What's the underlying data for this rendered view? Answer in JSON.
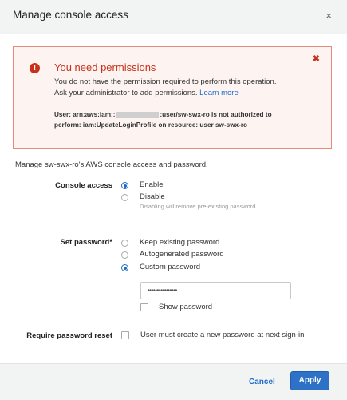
{
  "dialog": {
    "title": "Manage console access",
    "close_glyph": "×"
  },
  "alert": {
    "icon": "error-icon",
    "dismiss_glyph": "✖",
    "heading": "You need permissions",
    "message_line1": "You do not have the permission required to perform this operation.",
    "message_line2": "Ask your administrator to add permissions.",
    "learn_more": "Learn more",
    "detail_prefix": "User: arn:aws:iam::",
    "detail_suffix": ":user/sw-swx-ro is not authorized to",
    "detail_line2": "perform: iam:UpdateLoginProfile on resource: user sw-swx-ro",
    "color": "#c7311a"
  },
  "description": "Manage sw-swx-ro's AWS console access and password.",
  "console_access": {
    "label": "Console access",
    "options": [
      {
        "label": "Enable",
        "selected": true
      },
      {
        "label": "Disable",
        "selected": false
      }
    ],
    "disable_hint": "Disabling will remove pre-existing password."
  },
  "set_password": {
    "label": "Set password*",
    "options": [
      {
        "label": "Keep existing password",
        "selected": false
      },
      {
        "label": "Autogenerated password",
        "selected": false
      },
      {
        "label": "Custom password",
        "selected": true
      }
    ],
    "password_value": "••••••••••••••••",
    "show_password_label": "Show password",
    "show_password_checked": false
  },
  "reset": {
    "label": "Require password reset",
    "checkbox_label": "User must create a new password at next sign-in",
    "checked": false
  },
  "footer": {
    "cancel": "Cancel",
    "apply": "Apply",
    "accent": "#2d72c7"
  }
}
